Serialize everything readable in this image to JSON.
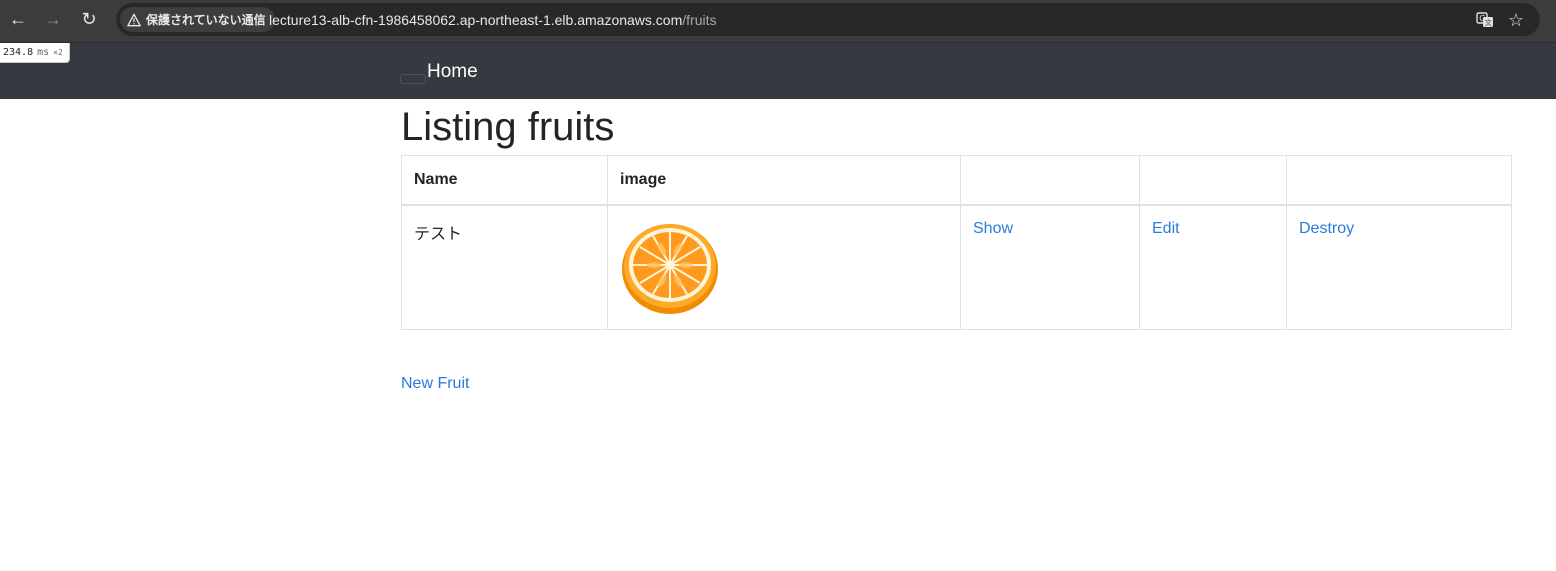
{
  "browser": {
    "security_label": "保護されていない通信",
    "url_host": "lecture13-alb-cfn-1986458062.ap-northeast-1.elb.amazonaws.com",
    "url_path": "/fruits",
    "icons": [
      "back-arrow-icon",
      "forward-arrow-icon",
      "reload-icon",
      "warning-icon",
      "translate-icon",
      "bookmark-star-icon"
    ]
  },
  "timing": {
    "value": "234.8",
    "unit": "ms",
    "multiplier": "×2"
  },
  "navbar": {
    "brand": "Home",
    "color": "#343a40"
  },
  "page": {
    "title": "Listing fruits",
    "table": {
      "headers": [
        "Name",
        "image",
        "",
        "",
        ""
      ],
      "rows": [
        {
          "name": "テスト",
          "image": "orange-slice",
          "show_label": "Show",
          "edit_label": "Edit",
          "destroy_label": "Destroy"
        }
      ]
    },
    "new_link": "New Fruit",
    "link_color": "#2b7bd9"
  }
}
